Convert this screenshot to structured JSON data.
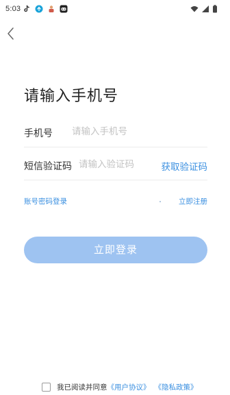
{
  "status_bar": {
    "time": "5:03",
    "left_icons": [
      "tiktok-icon",
      "notification-badge-icon",
      "app-icon",
      "game-icon"
    ],
    "right_icons": [
      "wifi-icon",
      "signal-icon",
      "battery-icon"
    ]
  },
  "header": {
    "back_icon": "chevron-left-icon"
  },
  "page": {
    "title": "请输入手机号"
  },
  "form": {
    "phone_label": "手机号",
    "phone_placeholder": "请输入手机号",
    "phone_value": "",
    "code_label": "短信验证码",
    "code_placeholder": "请输入验证码",
    "code_value": "",
    "get_code_label": "获取验证码"
  },
  "links": {
    "password_login": "账号密码登录",
    "register_now": "立即注册"
  },
  "login_button": {
    "label": "立即登录"
  },
  "agreement": {
    "prefix": "我已阅读并同意",
    "user_agreement": "《用户协议》",
    "privacy_policy": "《隐私政策》",
    "checked": false
  },
  "colors": {
    "accent": "#3a8fe0",
    "button_bg": "#9ec3f1",
    "title_text": "#222222",
    "placeholder": "#c3c3c3",
    "divider": "#ececec"
  }
}
